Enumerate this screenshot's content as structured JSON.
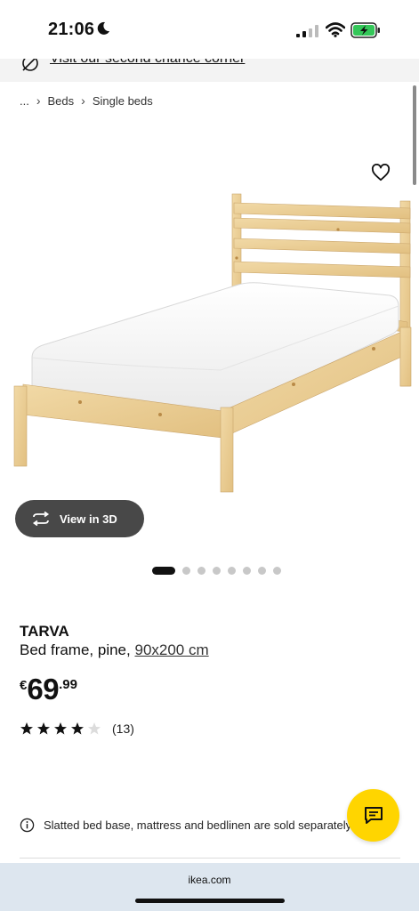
{
  "status_bar": {
    "time": "21:06"
  },
  "promo": {
    "link_text": "Visit our second chance corner"
  },
  "breadcrumb": {
    "ellipsis": "...",
    "items": [
      "Beds",
      "Single beds"
    ],
    "separator": "›"
  },
  "product": {
    "name": "TARVA",
    "description": "Bed frame, pine,",
    "size": "90x200 cm",
    "price": {
      "currency": "€",
      "integer": "69",
      "decimal": ".99"
    },
    "rating": {
      "value_out_of_5": 4,
      "review_count": "(13)"
    },
    "view_3d_label": "View in 3D",
    "image_count": 8,
    "active_image_index": 0,
    "info_note": "Slatted bed base, mattress and bedlinen are sold separately."
  },
  "browser": {
    "url": "ikea.com"
  },
  "colors": {
    "accent_yellow": "#ffd500",
    "button_dark": "#484848",
    "battery_green": "#34c759"
  },
  "icons": {
    "favorite": "heart-icon",
    "view3d": "rotate-3d-icon",
    "chat": "chat-icon",
    "info": "info-icon",
    "promo": "recycle-leaf-icon"
  }
}
